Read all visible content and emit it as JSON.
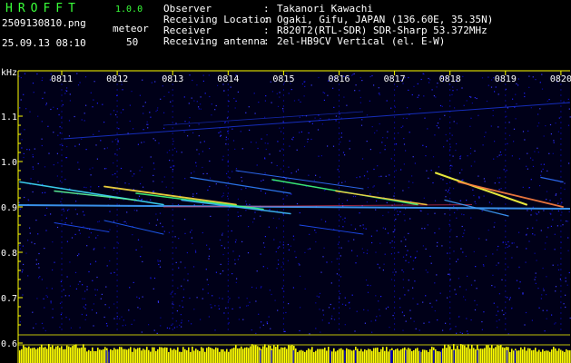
{
  "app": {
    "name": "HROFFT",
    "version": "1.0.0"
  },
  "file": {
    "name": "2509130810.png",
    "datetime": "25.09.13 08:10"
  },
  "meteor": {
    "label": "meteor",
    "count": "50"
  },
  "info": [
    {
      "label": "Observer",
      "value": "Takanori Kawachi"
    },
    {
      "label": "Receiving Location",
      "value": "Ogaki, Gifu, JAPAN (136.60E, 35.35N)"
    },
    {
      "label": "Receiver",
      "value": "R820T2(RTL-SDR) SDR-Sharp 53.372MHz"
    },
    {
      "label": "Receiving antenna",
      "value": "2el-HB9CV Vertical (el. E-W)"
    }
  ],
  "axis": {
    "unit": "kHz",
    "y_ticks": [
      "1.1",
      "1.0",
      "0.9",
      "0.8",
      "0.7",
      "0.6"
    ],
    "x_ticks": [
      "0811",
      "0812",
      "0813",
      "0814",
      "0815",
      "0816",
      "0817",
      "0818",
      "0819",
      "0820"
    ]
  },
  "colors": {
    "accent": "#39ff39",
    "axis": "#ffff00",
    "grid": "#0000cc",
    "level": "#ffff00"
  }
}
